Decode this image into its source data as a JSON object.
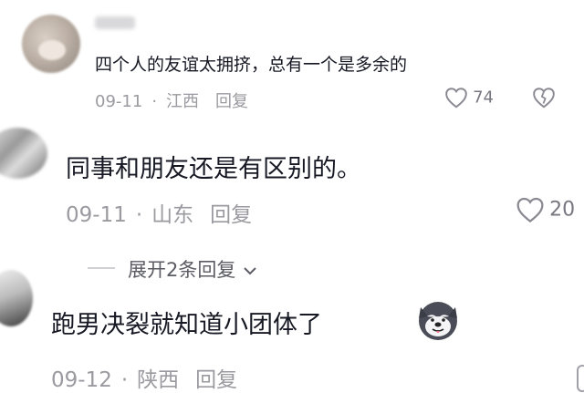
{
  "comments": [
    {
      "text": "四个人的友谊太拥挤，总有一个是多余的",
      "date": "09-11",
      "location": "江西",
      "reply_label": "回复",
      "likes": "74"
    },
    {
      "text": "同事和朋友还是有区别的。",
      "date": "09-11",
      "location": "山东",
      "reply_label": "回复",
      "likes": "20"
    },
    {
      "text": "跑男决裂就知道小团体了",
      "date": "09-12",
      "location": "陕西",
      "reply_label": "回复"
    }
  ],
  "expand_replies_label": "展开2条回复",
  "separator": "·",
  "icons": {
    "like": "heart-outline-icon",
    "dislike": "broken-heart-icon",
    "expand": "chevron-down-icon",
    "sticker": "husky-dog-emoji"
  }
}
